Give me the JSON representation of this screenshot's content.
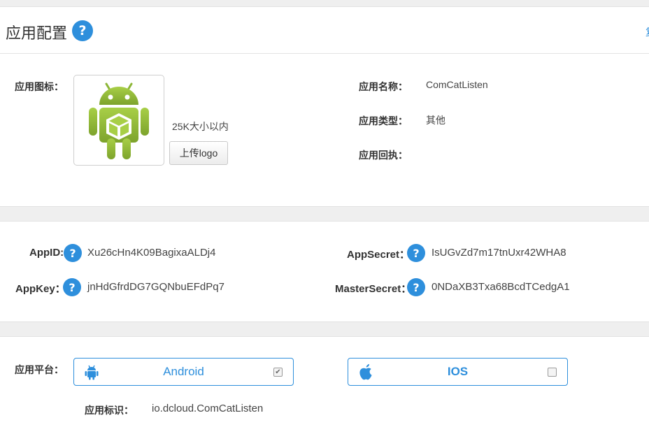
{
  "header": {
    "title": "应用配置",
    "help_icon": "question-circle-icon",
    "edge_glyph": "复"
  },
  "app_info": {
    "icon_label": "应用图标：",
    "icon_name": "android-robot-icon",
    "size_hint": "25K大小以内",
    "upload_button": "上传logo",
    "name_label": "应用名称：",
    "name_value": "ComCatListen",
    "type_label": "应用类型：",
    "type_value": "其他",
    "receipt_label": "应用回执："
  },
  "credentials": {
    "appid_label": "AppID:",
    "appid_value": "Xu26cHn4K09BagixaALDj4",
    "appkey_label": "AppKey：",
    "appkey_value": "jnHdGfrdDG7GQNbuEFdPq7",
    "appsecret_label": "AppSecret：",
    "appsecret_value": "IsUGvZd7m17tnUxr42WHA8",
    "mastersecret_label": "MasterSecret：",
    "mastersecret_value": "0NDaXB3Txa68BcdTCedgA1"
  },
  "platform": {
    "label": "应用平台：",
    "android": {
      "name": "Android",
      "checked": true,
      "icon": "android-icon"
    },
    "ios": {
      "name": "IOS",
      "checked": false,
      "icon": "apple-icon"
    },
    "identifier_label": "应用标识：",
    "identifier_value": "io.dcloud.ComCatListen"
  },
  "colors": {
    "accent": "#2e8fdc",
    "band": "#efefef",
    "android_green": "#97c03d"
  }
}
